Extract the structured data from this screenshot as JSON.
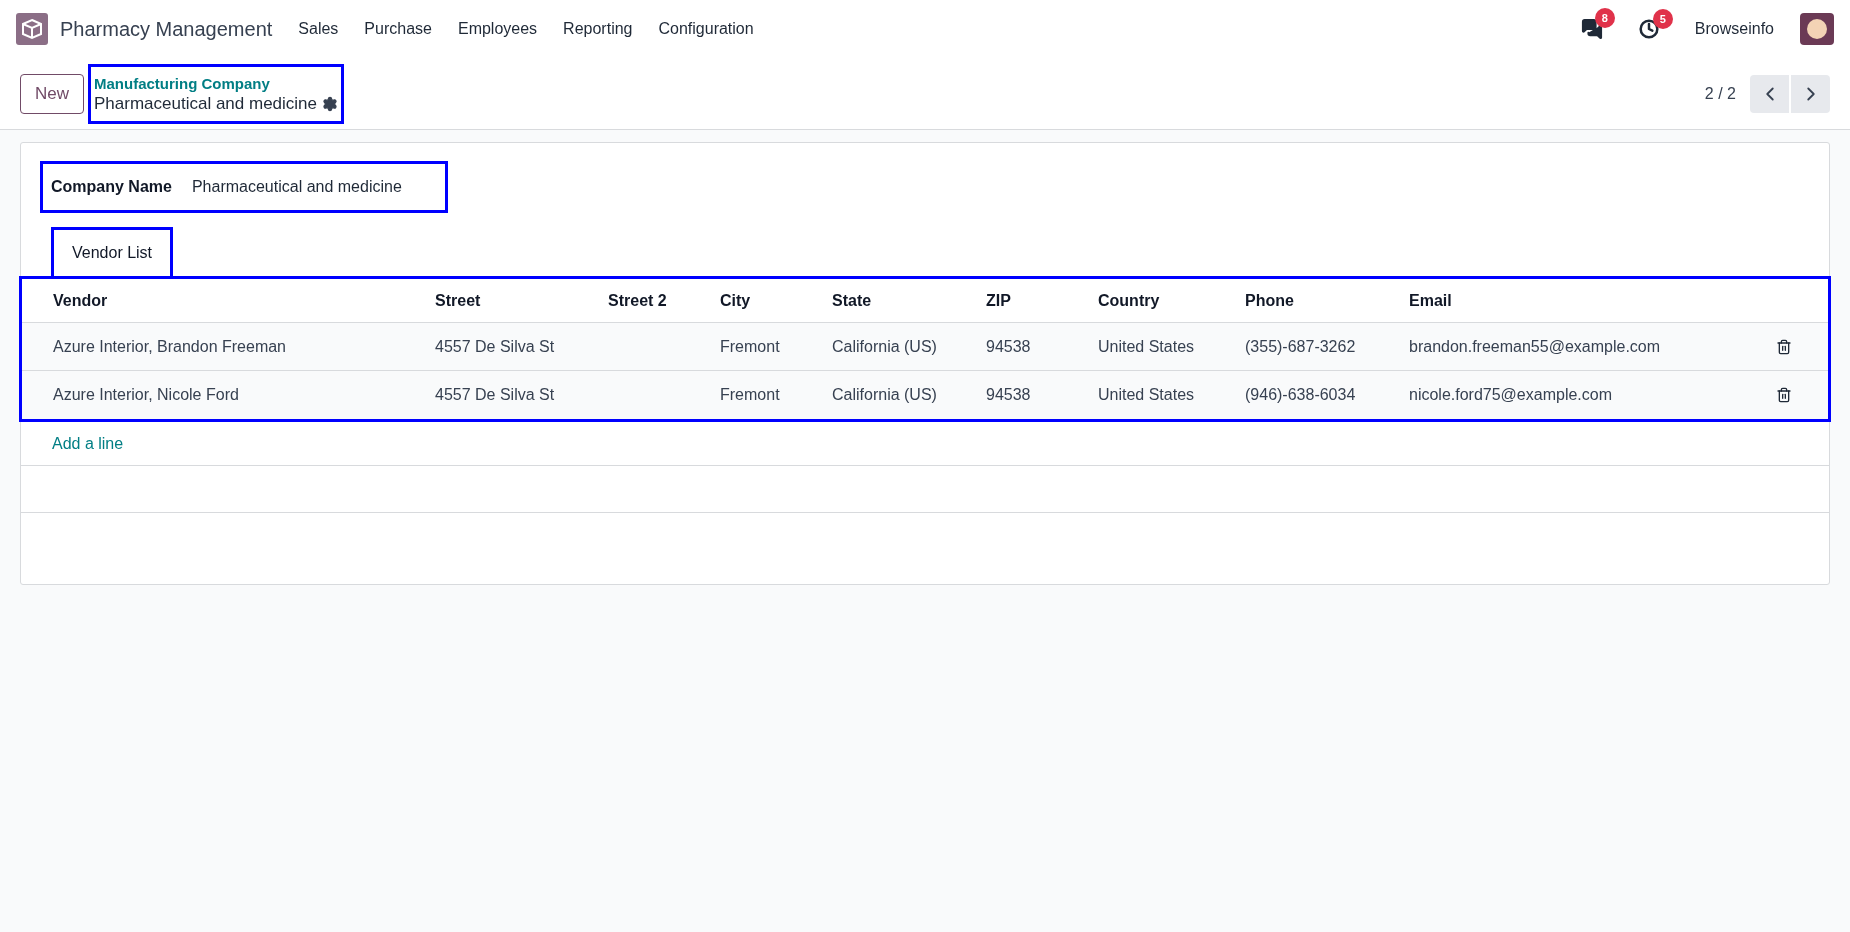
{
  "app": {
    "title": "Pharmacy Management"
  },
  "menu": [
    "Sales",
    "Purchase",
    "Employees",
    "Reporting",
    "Configuration"
  ],
  "systray": {
    "messages_count": "8",
    "activities_count": "5",
    "user": "Browseinfo"
  },
  "control_panel": {
    "new_button": "New",
    "breadcrumb": "Manufacturing Company",
    "record_title": "Pharmaceutical and medicine",
    "pager": "2 / 2"
  },
  "form": {
    "company_name_label": "Company Name",
    "company_name_value": "Pharmaceutical and medicine",
    "tabs": [
      {
        "label": "Vendor List",
        "selected": true
      }
    ],
    "table": {
      "columns": [
        "Vendor",
        "Street",
        "Street 2",
        "City",
        "State",
        "ZIP",
        "Country",
        "Phone",
        "Email"
      ],
      "rows": [
        [
          "Azure Interior, Brandon Freeman",
          "4557 De Silva St",
          "",
          "Fremont",
          "California (US)",
          "94538",
          "United States",
          "(355)-687-3262",
          "brandon.freeman55@example.com"
        ],
        [
          "Azure Interior, Nicole Ford",
          "4557 De Silva St",
          "",
          "Fremont",
          "California (US)",
          "94538",
          "United States",
          "(946)-638-6034",
          "nicole.ford75@example.com"
        ]
      ],
      "add_line": "Add a line"
    }
  }
}
